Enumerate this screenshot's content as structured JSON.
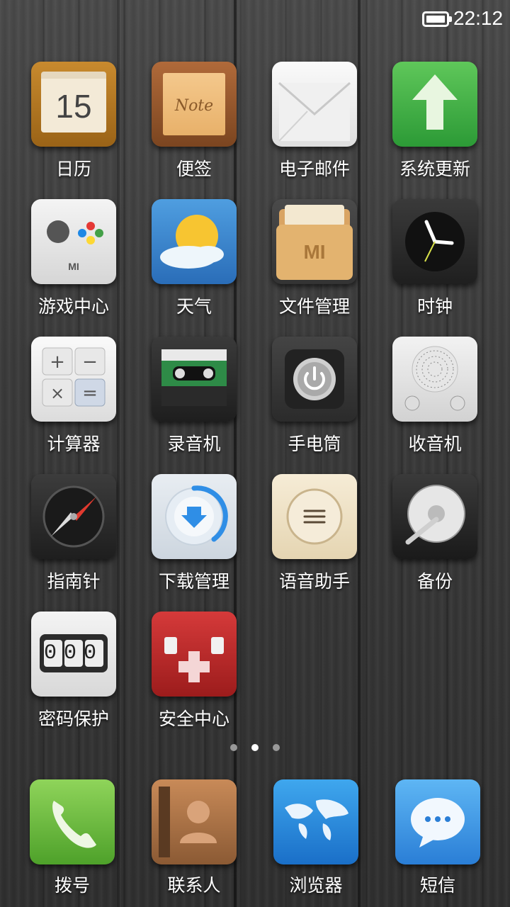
{
  "status_bar": {
    "time": "22:12"
  },
  "apps": [
    {
      "label": "日历",
      "icon": "calendar-icon",
      "text": "15"
    },
    {
      "label": "便签",
      "icon": "note-icon",
      "text": "Note"
    },
    {
      "label": "电子邮件",
      "icon": "mail-icon"
    },
    {
      "label": "系统更新",
      "icon": "update-icon"
    },
    {
      "label": "游戏中心",
      "icon": "gamepad-icon",
      "text": "MI"
    },
    {
      "label": "天气",
      "icon": "weather-icon"
    },
    {
      "label": "文件管理",
      "icon": "folder-icon",
      "text": "MI"
    },
    {
      "label": "时钟",
      "icon": "clock-icon"
    },
    {
      "label": "计算器",
      "icon": "calculator-icon"
    },
    {
      "label": "录音机",
      "icon": "cassette-icon"
    },
    {
      "label": "手电筒",
      "icon": "flashlight-icon"
    },
    {
      "label": "收音机",
      "icon": "radio-icon"
    },
    {
      "label": "指南针",
      "icon": "compass-icon"
    },
    {
      "label": "下载管理",
      "icon": "download-icon"
    },
    {
      "label": "语音助手",
      "icon": "voice-assistant-icon"
    },
    {
      "label": "备份",
      "icon": "backup-icon"
    },
    {
      "label": "密码保护",
      "icon": "password-icon",
      "text": "000"
    },
    {
      "label": "安全中心",
      "icon": "security-icon"
    }
  ],
  "pager": {
    "count": 3,
    "active_index": 1
  },
  "dock": [
    {
      "label": "拨号",
      "icon": "phone-icon"
    },
    {
      "label": "联系人",
      "icon": "contacts-icon"
    },
    {
      "label": "浏览器",
      "icon": "browser-icon"
    },
    {
      "label": "短信",
      "icon": "sms-icon"
    }
  ]
}
